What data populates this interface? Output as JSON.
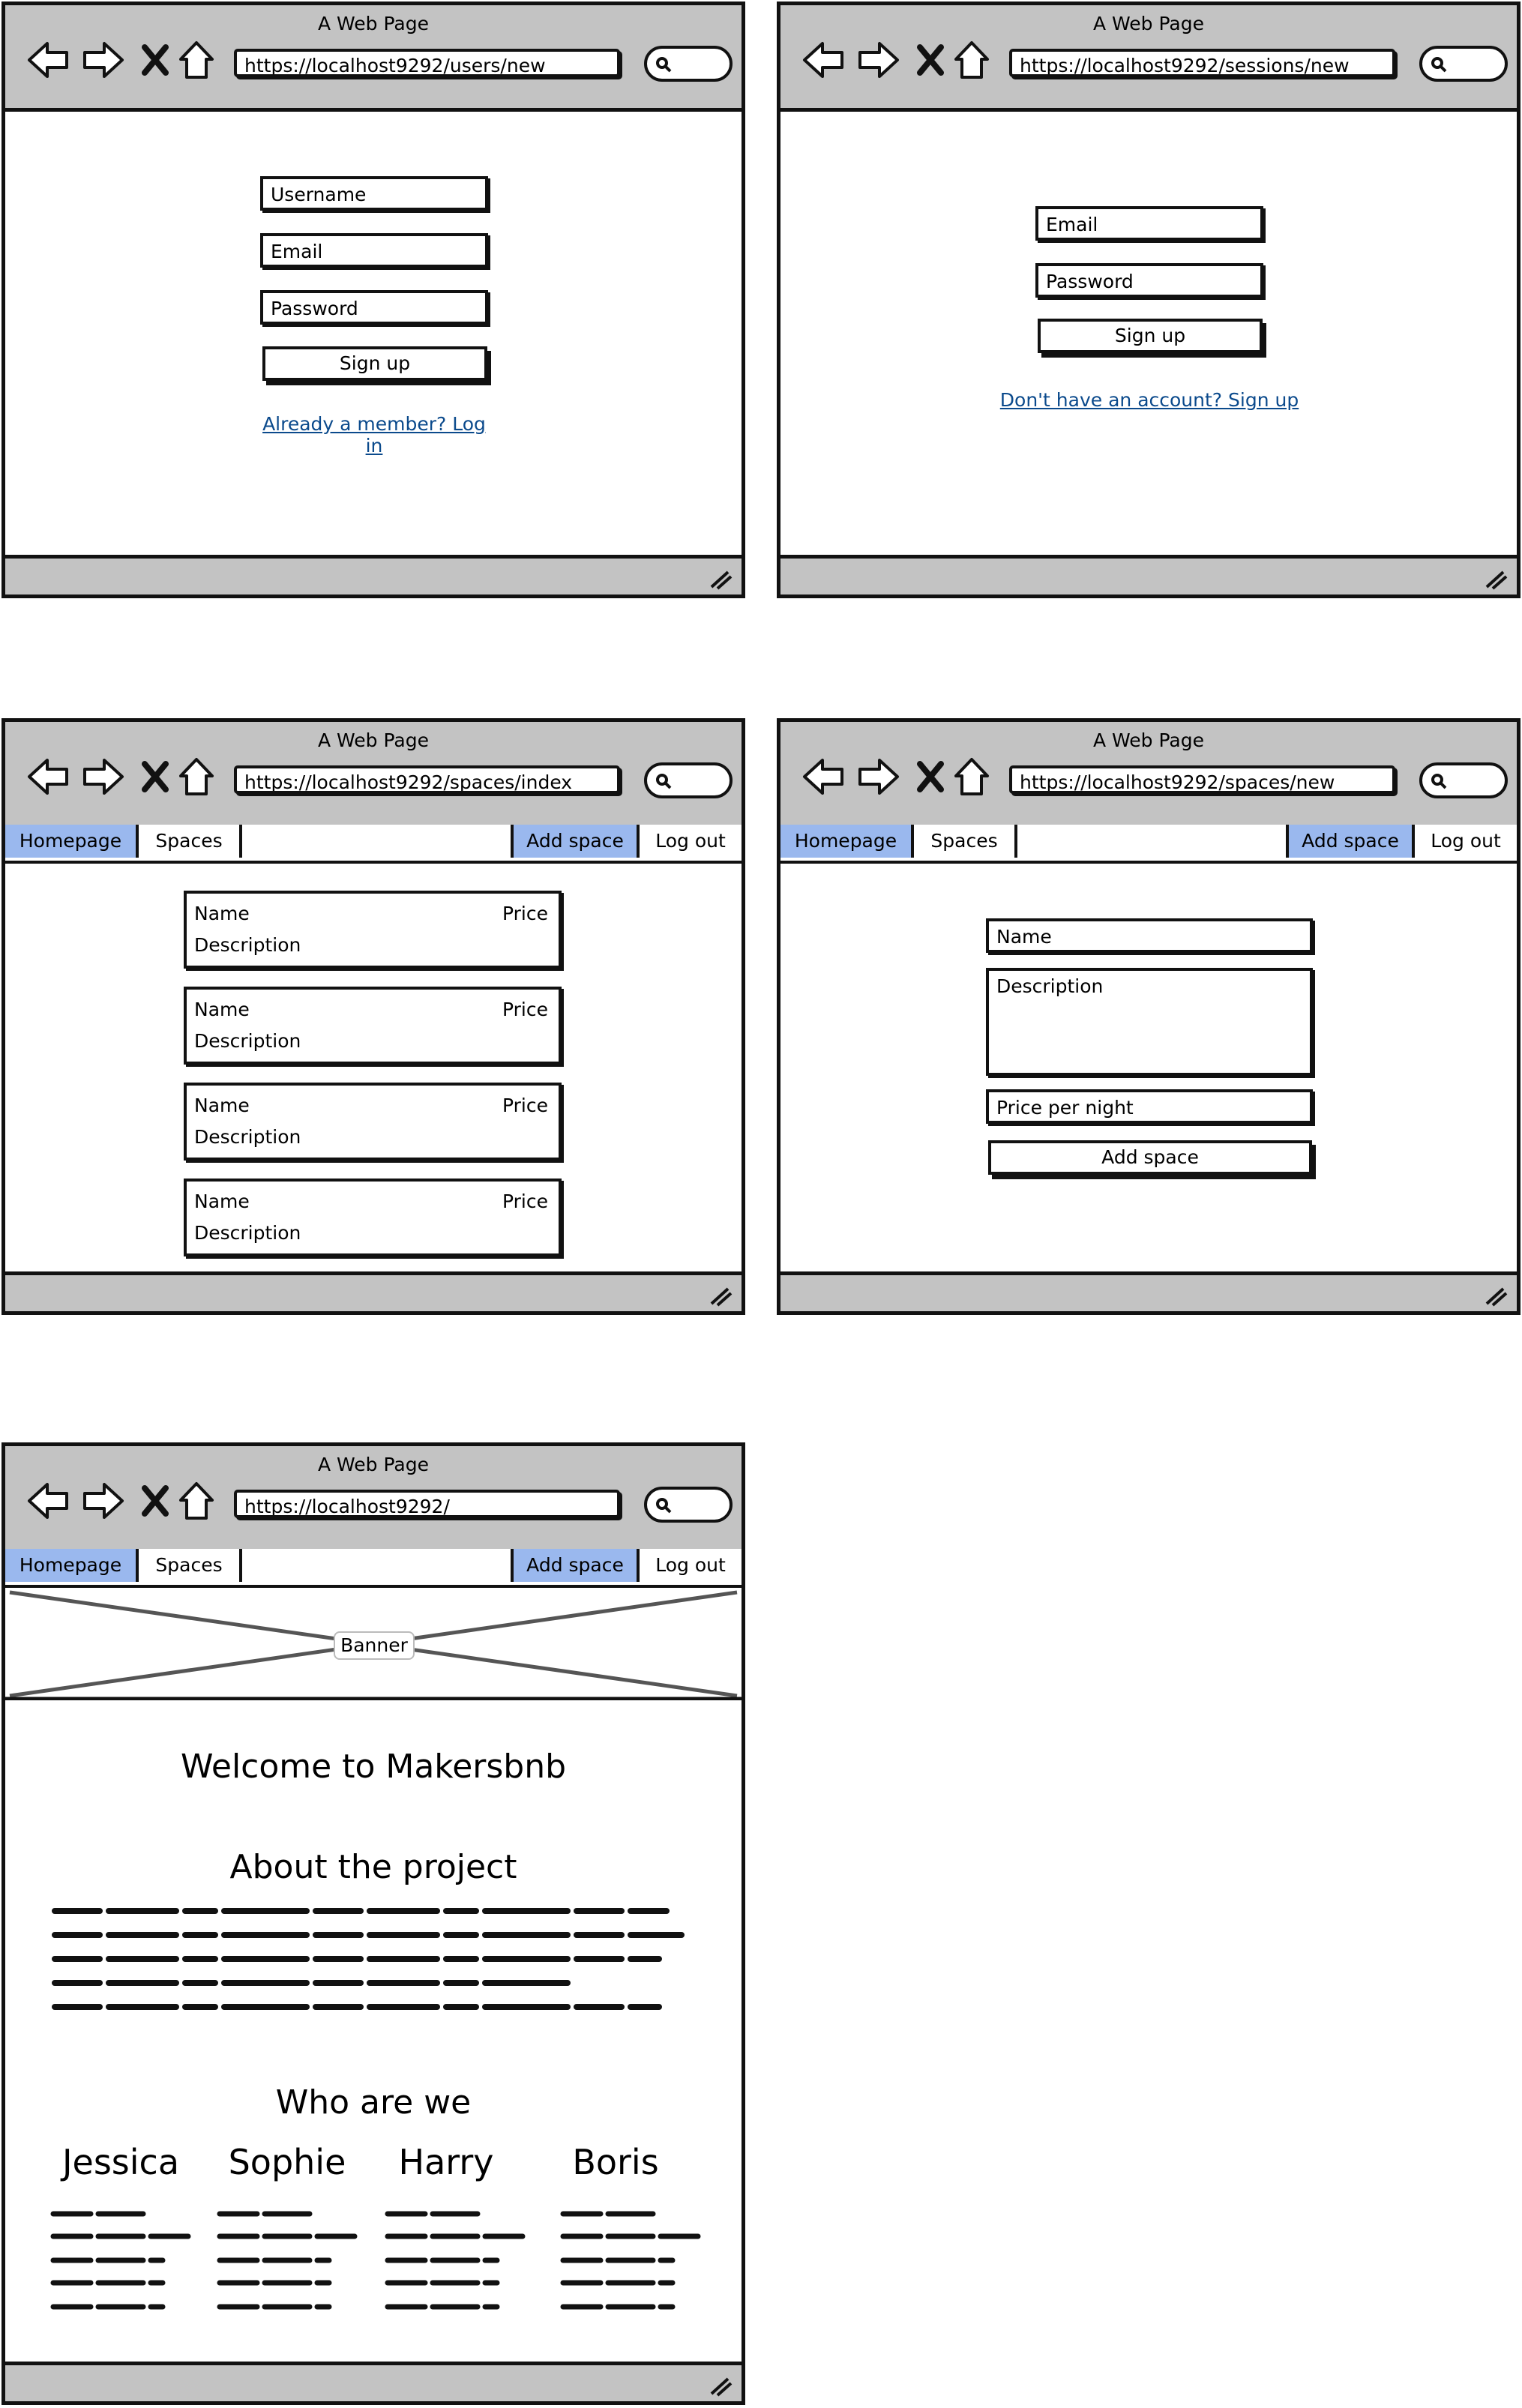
{
  "window_title": "A Web Page",
  "signup": {
    "url": "https://localhost9292/users/new",
    "username_label": "Username",
    "email_label": "Email",
    "password_label": "Password",
    "button_label": "Sign up",
    "link_label": "Already a member? Log in"
  },
  "login": {
    "url": "https://localhost9292/sessions/new",
    "email_label": "Email",
    "password_label": "Password",
    "button_label": "Sign up",
    "link_label": "Don't have an account? Sign up"
  },
  "nav": {
    "homepage": "Homepage",
    "spaces": "Spaces",
    "add_space": "Add space",
    "log_out": "Log out"
  },
  "spaces_index": {
    "url": "https://localhost9292/spaces/index",
    "cards": [
      {
        "name": "Name",
        "price": "Price",
        "description": "Description"
      },
      {
        "name": "Name",
        "price": "Price",
        "description": "Description"
      },
      {
        "name": "Name",
        "price": "Price",
        "description": "Description"
      },
      {
        "name": "Name",
        "price": "Price",
        "description": "Description"
      }
    ]
  },
  "spaces_new": {
    "url": "https://localhost9292/spaces/new",
    "name_label": "Name",
    "description_label": "Description",
    "price_label": "Price per night",
    "button_label": "Add space"
  },
  "home": {
    "url": "https://localhost9292/",
    "banner_label": "Banner",
    "welcome": "Welcome to Makersbnb",
    "about_heading": "About the project",
    "team_heading": "Who are we",
    "members": [
      "Jessica",
      "Sophie",
      "Harry",
      "Boris"
    ]
  },
  "colors": {
    "chrome_grey": "#c3c3c3",
    "nav_selected": "#9ab8ee",
    "link_blue": "#0b4a8c"
  },
  "icons": [
    "back-arrow-icon",
    "forward-arrow-icon",
    "close-x-icon",
    "home-icon",
    "search-icon",
    "resize-grip-icon"
  ]
}
